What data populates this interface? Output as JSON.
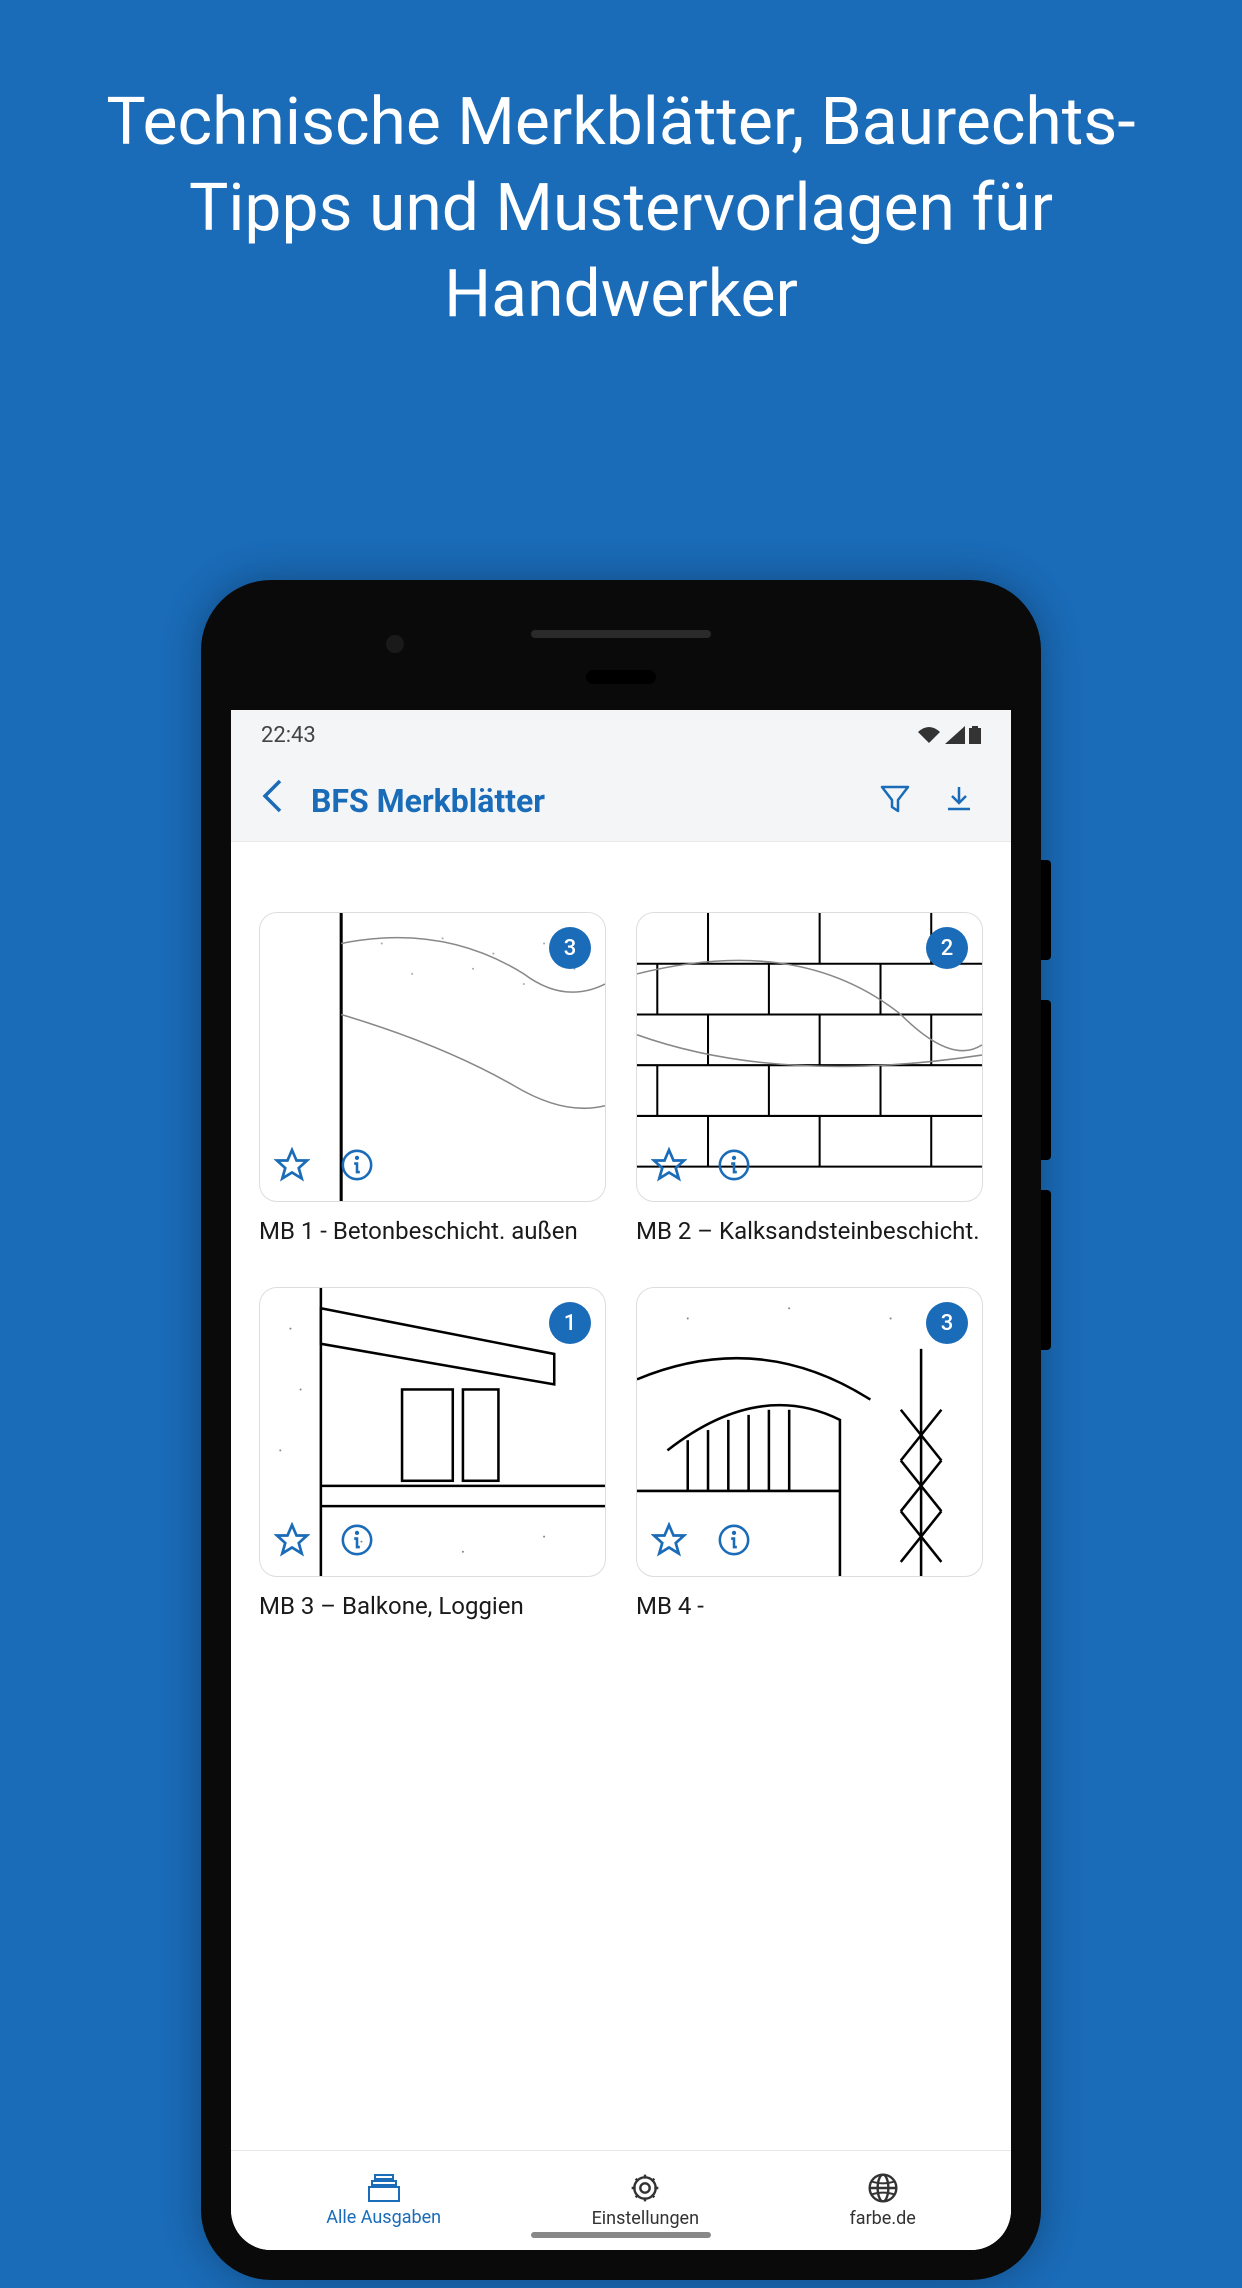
{
  "promo": "Technische Merkblätter, Baurechts-Tipps und Mustervorlagen für Handwerker",
  "status": {
    "time": "22:43"
  },
  "nav": {
    "title": "BFS Merkblätter"
  },
  "cards": [
    {
      "badge": "3",
      "title": "MB 1 - Betonbeschicht. außen"
    },
    {
      "badge": "2",
      "title": "MB 2 – Kalksandsteinbeschicht."
    },
    {
      "badge": "1",
      "title": "MB 3 – Balkone, Loggien"
    },
    {
      "badge": "3",
      "title": "MB 4 -"
    }
  ],
  "tabs": [
    {
      "label": "Alle Ausgaben",
      "active": true
    },
    {
      "label": "Einstellungen",
      "active": false
    },
    {
      "label": "farbe.de",
      "active": false
    }
  ]
}
